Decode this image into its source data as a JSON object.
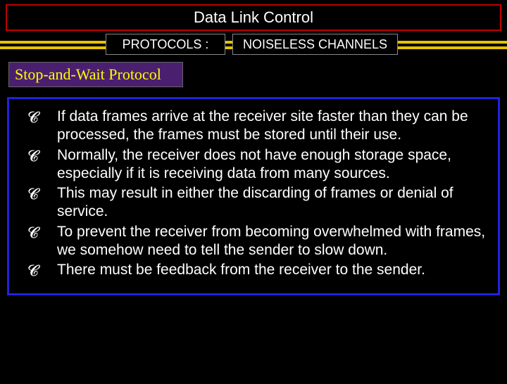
{
  "title": "Data Link Control",
  "protocols_label": "PROTOCOLS :",
  "channels_label": "NOISELESS CHANNELS",
  "subheading": "Stop-and-Wait Protocol",
  "bullets": [
    "If data frames arrive at the receiver site faster than they can be processed, the frames must be stored until their use.",
    "Normally, the receiver does not have enough storage space, especially if it is receiving data from many sources.",
    "This may result in either the discarding of frames or denial of service.",
    "To prevent the receiver from becoming overwhelmed with frames, we somehow need to tell the sender to slow down.",
    "There must be feedback from the receiver to the sender."
  ]
}
